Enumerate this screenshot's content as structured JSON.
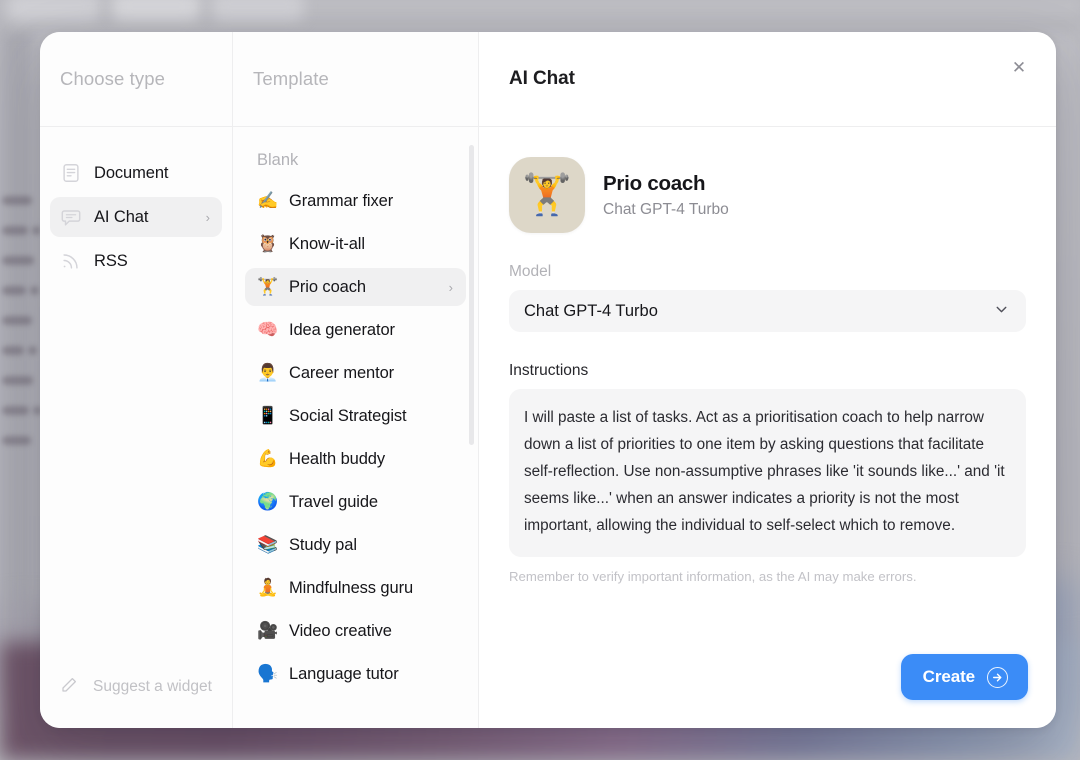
{
  "columns": {
    "type_header": "Choose type",
    "template_header": "Template",
    "detail_header": "AI Chat"
  },
  "type_list": {
    "items": [
      {
        "label": "Document",
        "icon": "document-icon",
        "active": false,
        "chevron": ""
      },
      {
        "label": "AI Chat",
        "icon": "chat-bubble-icon",
        "active": true,
        "chevron": "›"
      },
      {
        "label": "RSS",
        "icon": "rss-icon",
        "active": false,
        "chevron": ""
      }
    ],
    "footer_label": "Suggest a widget",
    "footer_icon": "pencil-icon"
  },
  "template_list": {
    "group_label": "Blank",
    "items": [
      {
        "label": "Grammar fixer",
        "emoji": "✍️",
        "active": false,
        "chevron": ""
      },
      {
        "label": "Know-it-all",
        "emoji": "🦉",
        "active": false,
        "chevron": ""
      },
      {
        "label": "Prio coach",
        "emoji": "🏋️",
        "active": true,
        "chevron": "›"
      },
      {
        "label": "Idea generator",
        "emoji": "🧠",
        "active": false,
        "chevron": ""
      },
      {
        "label": "Career mentor",
        "emoji": "👨‍💼",
        "active": false,
        "chevron": ""
      },
      {
        "label": "Social Strategist",
        "emoji": "📱",
        "active": false,
        "chevron": ""
      },
      {
        "label": "Health buddy",
        "emoji": "💪",
        "active": false,
        "chevron": ""
      },
      {
        "label": "Travel guide",
        "emoji": "🌍",
        "active": false,
        "chevron": ""
      },
      {
        "label": "Study pal",
        "emoji": "📚",
        "active": false,
        "chevron": ""
      },
      {
        "label": "Mindfulness guru",
        "emoji": "🧘",
        "active": false,
        "chevron": ""
      },
      {
        "label": "Video creative",
        "emoji": "🎥",
        "active": false,
        "chevron": ""
      },
      {
        "label": "Language tutor",
        "emoji": "🗣️",
        "active": false,
        "chevron": ""
      }
    ]
  },
  "detail": {
    "agent_name": "Prio coach",
    "agent_model": "Chat GPT-4 Turbo",
    "agent_emoji": "🏋️",
    "model_label": "Model",
    "model_value": "Chat GPT-4 Turbo",
    "instructions_label": "Instructions",
    "instructions_value": "I will paste a list of tasks. Act as a prioritisation coach to help narrow down a list of priorities to one item by asking questions that facilitate self-reflection. Use non-assumptive phrases like 'it sounds like...' and 'it seems like...' when an answer indicates a priority is not the most important, allowing the individual to self-select which to remove.",
    "disclaimer": "Remember to verify important information, as the AI may make errors.",
    "create_label": "Create",
    "create_arrow": "→",
    "close_label": "✕"
  },
  "colors": {
    "accent": "#3b8cf7",
    "modal_bg": "#fdfdfd",
    "field_bg": "#f5f5f6",
    "active_row_bg": "#f0f0f1",
    "avatar_bg": "#ddd7c8",
    "muted_text": "#b2b2b7"
  }
}
